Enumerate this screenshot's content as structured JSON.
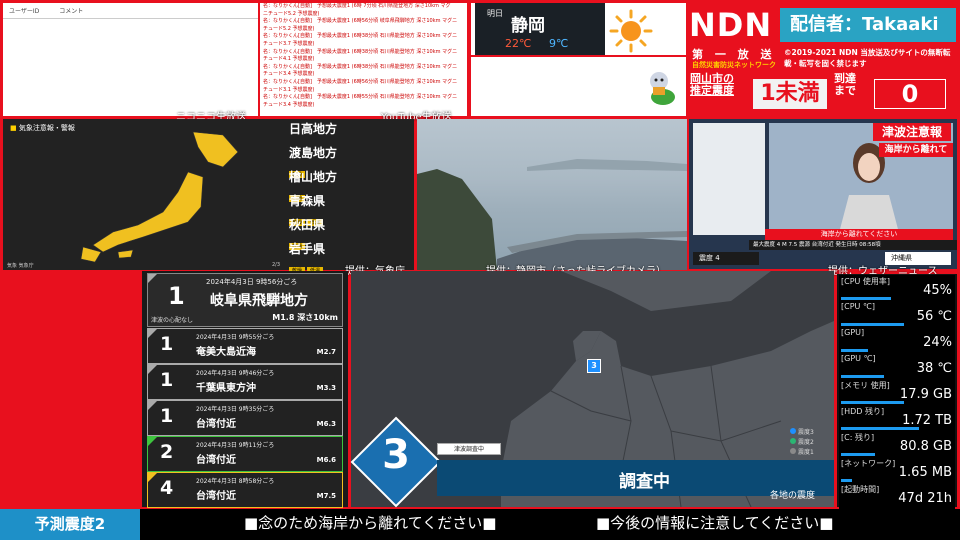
{
  "comments": {
    "col1_header": "ユーザーID",
    "col2_header": "コメント",
    "lines": [
      "名：なりかくん[自動]　予想最大震度1 (6時 7分頃 石川県能登地方 深さ10km マグ",
      "ニチュード5.2 予想震度)",
      "名：なりかくん[自動]　予想最大震度1 (6時56分頃 岐阜県飛騨地方 深さ10km マグニ",
      "チュード5.2 予想震度)",
      "名：なりかくん[自動]　予想最大震度1 (6時38分頃 石川県能登地方 深さ10km マグニ",
      "チュード3.7 予想震度)",
      "名：なりかくん[自動]　予想最大震度1 (6時38分頃 石川県能登地方 深さ10km マグニ",
      "チュード4.1 予想震度)",
      "名：なりかくん[自動]　予想最大震度1 (6時38分頃 石川県能登地方 深さ10km マグニ",
      "チュード3.4 予想震度)",
      "名：なりかくん[自動]　予想最大震度1 (6時56分頃 石川県能登地方 深さ10km マグニ",
      "チュード3.1 予想震度)",
      "名：なりかくん[自動]　予想最大震度1 (6時55分頃 石川県能登地方 深さ10km マグニ",
      "チュード3.4 予想震度)"
    ]
  },
  "weather": {
    "label": "明日",
    "city": "静岡",
    "high": "22℃",
    "low": "9℃"
  },
  "broadcast": {
    "logo": "NDN",
    "caster": "配信者：Takaaki",
    "first_report": "第 一 放 送",
    "first_report_sub": "自然災害防災ネットワーク",
    "copyright": "©2019-2021 NDN 当放送及びサイトの無断転載・転写を固く禁じます",
    "okayama_label_1": "岡山市の",
    "okayama_label_2": "推定震度",
    "okayama_value": "1未満",
    "arrival_label_1": "到達",
    "arrival_label_2": "まで",
    "arrival_value": "0"
  },
  "captions": {
    "niconico": "ニコニコ生放送",
    "youtube": "YouTube生放送",
    "credit_jma": "提供：気象庁",
    "credit_camera": "提供：静岡市（さった峠ライブカメラ）",
    "credit_wni": "提供：ウェザーニュース"
  },
  "warning_map": {
    "title": "気象注意報・警報",
    "regions": [
      {
        "name": "日高地方",
        "badges": []
      },
      {
        "name": "渡島地方",
        "badges": [
          "乾燥"
        ]
      },
      {
        "name": "檜山地方",
        "badges": [
          "乾燥"
        ]
      },
      {
        "name": "青森県",
        "badges": [
          "乾燥",
          "低温"
        ]
      },
      {
        "name": "秋田県",
        "badges": [
          "乾燥"
        ]
      },
      {
        "name": "岩手県",
        "badges": [
          "乾燥",
          "低温"
        ]
      }
    ],
    "page": "2/3",
    "bottom_left": "気象 気象庁"
  },
  "news": {
    "banner": "津波注意報",
    "banner_sub": "海岸から離れて",
    "ticker": "海岸から離れてください",
    "eq_line": "最大震度 4  M 7.5  震源 台湾付近  発生日時 08:58頃",
    "intensity_tag": "震度 4",
    "pref": "沖縄県"
  },
  "eq_list": {
    "latest": {
      "intensity": "1",
      "time": "2024年4月3日 9時56分ごろ",
      "place": "岐阜県飛騨地方",
      "tsunami": "津波の心配なし",
      "magdepth": "M1.8 深さ10km"
    },
    "rows": [
      {
        "intensity": "1",
        "time": "2024年4月3日 9時55分ごろ",
        "place": "奄美大島近海",
        "mag": "M2.7",
        "color": "#aaaaaa"
      },
      {
        "intensity": "1",
        "time": "2024年4月3日 9時46分ごろ",
        "place": "千葉県東方沖",
        "mag": "M3.3",
        "color": "#aaaaaa"
      },
      {
        "intensity": "1",
        "time": "2024年4月3日 9時35分ごろ",
        "place": "台湾付近",
        "mag": "M6.3",
        "color": "#aaaaaa"
      },
      {
        "intensity": "2",
        "time": "2024年4月3日 9時11分ごろ",
        "place": "台湾付近",
        "mag": "M6.6",
        "color": "#3ec43e"
      },
      {
        "intensity": "4",
        "time": "2024年4月3日 8時58分ごろ",
        "place": "台湾付近",
        "mag": "M7.5",
        "color": "#f0c020"
      }
    ]
  },
  "center_map": {
    "max_intensity": "3",
    "epicenter_marker": "3",
    "tsunami_tag": "津波調査中",
    "status": "調査中",
    "area_label": "各地の震度",
    "legend": [
      {
        "label": "震度3",
        "color": "#1e90ff"
      },
      {
        "label": "震度2",
        "color": "#2bb673"
      },
      {
        "label": "震度1",
        "color": "#8a8a8a"
      }
    ]
  },
  "system_stats": [
    {
      "label": "[CPU 使用率]",
      "value": "45%",
      "bar": 0.45
    },
    {
      "label": "[CPU ℃]",
      "value": "56 ℃",
      "bar": 0.56
    },
    {
      "label": "[GPU]",
      "value": "24%",
      "bar": 0.24
    },
    {
      "label": "[GPU ℃]",
      "value": "38 ℃",
      "bar": 0.38
    },
    {
      "label": "[メモリ 使用]",
      "value": "17.9 GB",
      "bar": 0.56
    },
    {
      "label": "[HDD 残り]",
      "value": "1.72 TB",
      "bar": 0.7
    },
    {
      "label": "[C: 残り]",
      "value": "80.8 GB",
      "bar": 0.3
    },
    {
      "label": "[ネットワーク]",
      "value": "1.65 MB",
      "bar": 0.1
    },
    {
      "label": "[起動時間]",
      "value": "47d 21h",
      "bar": 0.0
    }
  ],
  "bottom": {
    "predicted": "予測震度2",
    "ticker_1": "■念のため海岸から離れてください■",
    "ticker_2": "■今後の情報に注意してください■"
  }
}
